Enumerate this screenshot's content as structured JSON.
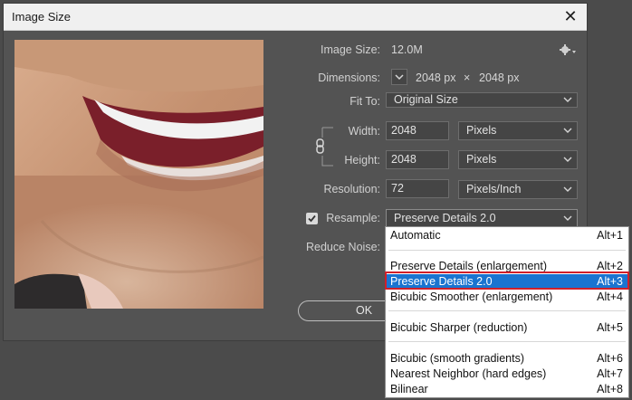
{
  "dialog": {
    "title": "Image Size",
    "image_size_label": "Image Size:",
    "image_size_value": "12.0M",
    "dimensions_label": "Dimensions:",
    "dim_width": "2048 px",
    "dim_times": "×",
    "dim_height": "2048 px",
    "fit_to_label": "Fit To:",
    "fit_to_value": "Original Size",
    "width_label": "Width:",
    "width_value": "2048",
    "width_unit": "Pixels",
    "height_label": "Height:",
    "height_value": "2048",
    "height_unit": "Pixels",
    "resolution_label": "Resolution:",
    "resolution_value": "72",
    "resolution_unit": "Pixels/Inch",
    "resample_label": "Resample:",
    "resample_checked": true,
    "resample_value": "Preserve Details 2.0",
    "reduce_noise_label": "Reduce Noise:",
    "ok_label": "OK"
  },
  "dropdown": {
    "items": [
      {
        "name": "Automatic",
        "shortcut": "Alt+1"
      },
      {
        "name": "Preserve Details (enlargement)",
        "shortcut": "Alt+2"
      },
      {
        "name": "Preserve Details 2.0",
        "shortcut": "Alt+3",
        "selected": true
      },
      {
        "name": "Bicubic Smoother (enlargement)",
        "shortcut": "Alt+4"
      },
      {
        "name": "Bicubic Sharper (reduction)",
        "shortcut": "Alt+5"
      },
      {
        "name": "Bicubic (smooth gradients)",
        "shortcut": "Alt+6"
      },
      {
        "name": "Nearest Neighbor (hard edges)",
        "shortcut": "Alt+7"
      },
      {
        "name": "Bilinear",
        "shortcut": "Alt+8"
      }
    ]
  },
  "colors": {
    "dialog_bg": "#535353",
    "selection": "#1a74d0",
    "highlight_box": "#d0202a"
  }
}
